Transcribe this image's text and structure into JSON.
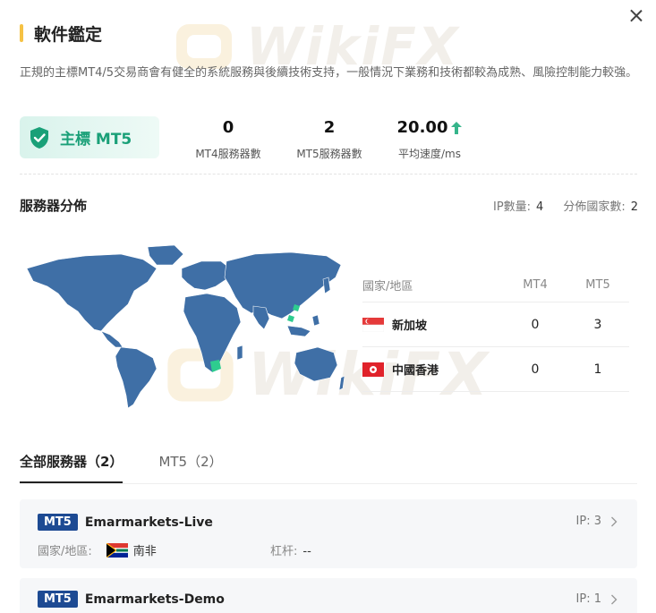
{
  "header": {
    "title": "軟件鑑定",
    "description": "正規的主標MT4/5交易商會有健全的系統服務與後續技術支持，一般情況下業務和技術都較為成熟、風險控制能力較強。"
  },
  "watermark": {
    "text": "WikiFX"
  },
  "badge": {
    "label": "主標 MT5",
    "color": "#1aa078"
  },
  "stats": [
    {
      "value": "0",
      "caption": "MT4服務器數"
    },
    {
      "value": "2",
      "caption": "MT5服務器數"
    },
    {
      "value": "20.00",
      "caption": "平均速度/ms"
    }
  ],
  "server_distribution": {
    "title": "服務器分佈",
    "ip_count_label": "IP數量:",
    "ip_count": "4",
    "country_count_label": "分佈國家數:",
    "country_count": "2",
    "table": {
      "headers": [
        "國家/地區",
        "MT4",
        "MT5"
      ],
      "rows": [
        {
          "country": "新加坡",
          "flag": "singapore-flag",
          "mt4": "0",
          "mt5": "3"
        },
        {
          "country": "中國香港",
          "flag": "hongkong-flag",
          "mt4": "0",
          "mt5": "1"
        }
      ]
    }
  },
  "tabs": [
    {
      "label": "全部服務器（2）",
      "active": true
    },
    {
      "label": "MT5（2）",
      "active": false
    }
  ],
  "servers": [
    {
      "tag": "MT5",
      "name": "Emarmarkets-Live",
      "ip_label": "IP:",
      "ip": "3",
      "country_label": "國家/地區:",
      "country": "南非",
      "flag": "south-africa-flag",
      "leverage_label": "杠杆:",
      "leverage": "--"
    },
    {
      "tag": "MT5",
      "name": "Emarmarkets-Demo",
      "ip_label": "IP:",
      "ip": "1"
    }
  ],
  "colors": {
    "accent": "#f6c244",
    "tag_blue": "#1d4a93",
    "map_land": "#3f6fa6",
    "map_marker": "#2ecc8f"
  }
}
